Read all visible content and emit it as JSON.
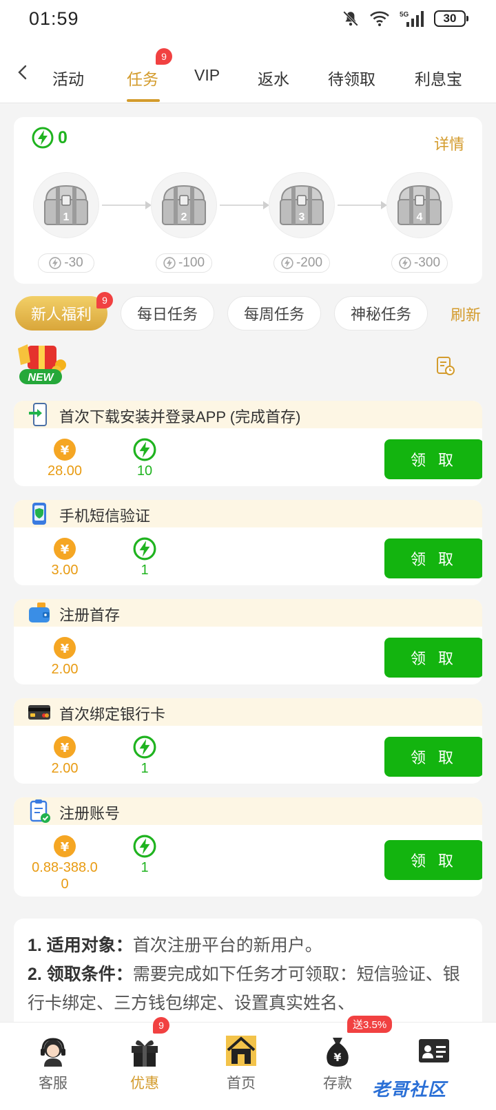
{
  "status_bar": {
    "time": "01:59",
    "battery": "30",
    "network": "5G"
  },
  "tabs": [
    {
      "label": "活动"
    },
    {
      "label": "任务",
      "badge": "9",
      "active": true
    },
    {
      "label": "VIP"
    },
    {
      "label": "返水"
    },
    {
      "label": "待领取"
    },
    {
      "label": "利息宝"
    }
  ],
  "energy": {
    "count": "0",
    "detail_label": "详情"
  },
  "chests": [
    {
      "number": "1",
      "cost": "-30"
    },
    {
      "number": "2",
      "cost": "-100"
    },
    {
      "number": "3",
      "cost": "-200"
    },
    {
      "number": "4",
      "cost": "-300"
    }
  ],
  "categories": [
    {
      "label": "新人福利",
      "badge": "9",
      "active": true
    },
    {
      "label": "每日任务"
    },
    {
      "label": "每周任务"
    },
    {
      "label": "神秘任务"
    }
  ],
  "refresh_label": "刷新",
  "new_tag": "NEW",
  "tasks": [
    {
      "title": "首次下载安装并登录APP (完成首存)",
      "icon": "download-app-icon",
      "coin": "28.00",
      "energy": "10",
      "button": "领 取"
    },
    {
      "title": "手机短信验证",
      "icon": "phone-shield-icon",
      "coin": "3.00",
      "energy": "1",
      "button": "领 取"
    },
    {
      "title": "注册首存",
      "icon": "wallet-icon",
      "coin": "2.00",
      "energy": "",
      "button": "领 取"
    },
    {
      "title": "首次绑定银行卡",
      "icon": "bank-card-icon",
      "coin": "2.00",
      "energy": "1",
      "button": "领 取"
    },
    {
      "title": "注册账号",
      "icon": "clipboard-check-icon",
      "coin": "0.88-388.0",
      "coin_line2": "0",
      "energy": "1",
      "button": "领 取"
    }
  ],
  "rules": {
    "item1_label": "1. 适用对象：",
    "item1_text": "首次注册平台的新用户。",
    "item2_label": "2. 领取条件：",
    "item2_text": "需要完成如下任务才可领取：短信验证、银行卡绑定、三方钱包绑定、设置真实姓名、"
  },
  "bottom_nav": [
    {
      "label": "客服"
    },
    {
      "label": "优惠",
      "badge": "9",
      "active": true
    },
    {
      "label": "首页"
    },
    {
      "label": "存款",
      "promo": "送3.5%"
    },
    {
      "label": ""
    }
  ],
  "watermark": "老哥社区",
  "colors": {
    "accent": "#d39b2c",
    "claim_green": "#13b40f",
    "energy_green": "#1fb31f",
    "coin_orange": "#f5a623",
    "badge_red": "#f14141"
  }
}
